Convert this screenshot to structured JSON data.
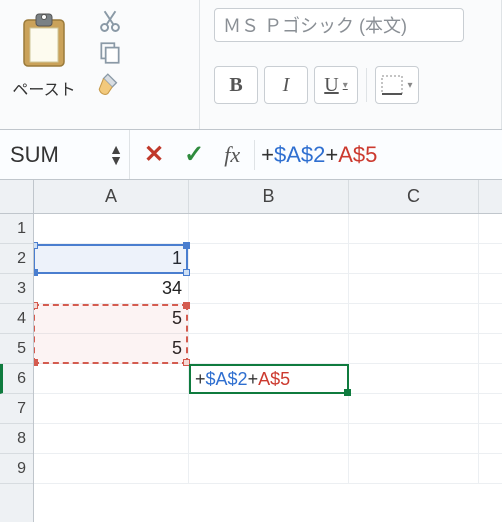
{
  "ribbon": {
    "paste_label": "ペースト",
    "font_name": "ＭＳ Ｐゴシック (本文)",
    "bold": "B",
    "italic": "I",
    "underline": "U"
  },
  "formula_bar": {
    "name_box": "SUM",
    "cancel": "✕",
    "enter": "✓",
    "fx": "fx",
    "plus1": "+",
    "ref1": "$A$2",
    "plus2": "+",
    "ref2": "A$5"
  },
  "grid": {
    "columns": [
      "A",
      "B",
      "C"
    ],
    "rows": [
      "1",
      "2",
      "3",
      "4",
      "5",
      "6",
      "7",
      "8",
      "9"
    ],
    "data": {
      "A2": "1",
      "A3": "34",
      "A4": "5",
      "A5": "5"
    },
    "editing_cell": {
      "address": "B6",
      "plus1": "+",
      "ref1": "$A$2",
      "plus2": "+",
      "ref2": "A$5"
    },
    "ref_ranges": [
      {
        "name": "ref-blue",
        "range": "A2"
      },
      {
        "name": "ref-red",
        "range": "A4:A5"
      }
    ]
  }
}
